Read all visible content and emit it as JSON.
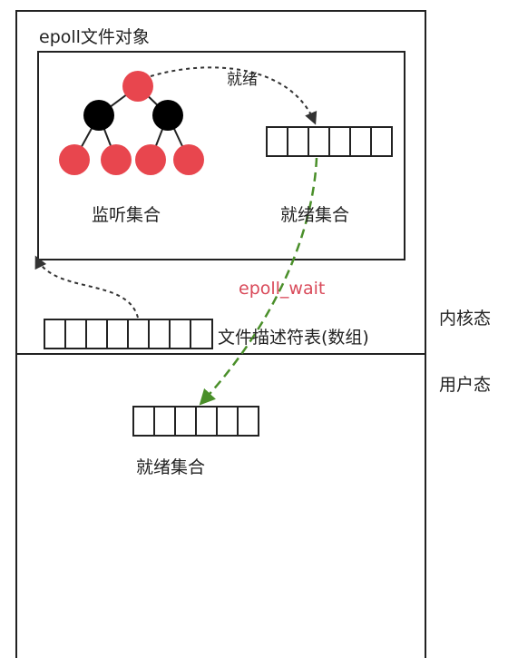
{
  "kernel_box": {
    "epoll_object_title": "epoll文件对象",
    "rbtree_label": "监听集合",
    "ready_list_label": "就绪集合",
    "ready_arrow_label": "就绪",
    "fd_table_label": "文件描述符表(数组)"
  },
  "side_labels": {
    "kernel_mode": "内核态",
    "user_mode": "用户态"
  },
  "epoll_wait_label": "epoll_wait",
  "user_box": {
    "ready_list_label": "就绪集合"
  },
  "colors": {
    "red_node": "#e8464e",
    "black_node": "#000000",
    "wait_arrow": "#4a8f2a",
    "epoll_wait_text": "#d94a5a"
  }
}
